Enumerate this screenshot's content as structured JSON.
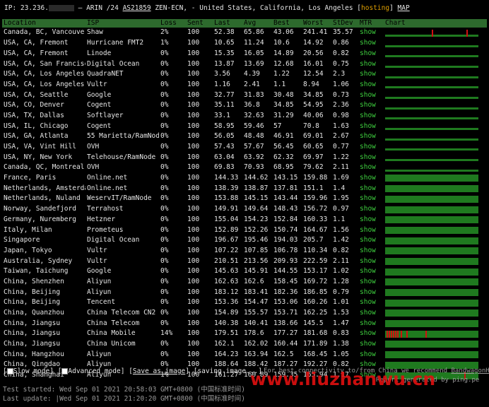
{
  "header": {
    "ip_prefix": "IP: 23.236.",
    "ip_tail": " – ARIN /24 ",
    "asn": "AS21859",
    "rest": " ZEN-ECN, - United States, California, Los Angeles [",
    "hosting": "hosting",
    "close": "] ",
    "map": "MAP"
  },
  "columns": [
    "Location",
    "ISP",
    "Loss",
    "Sent",
    "Last",
    "Avg",
    "Best",
    "Worst",
    "StDev",
    "MTR",
    "Chart"
  ],
  "rows": [
    {
      "location": "Canada, BC, Vancouver",
      "isp": "Shaw",
      "loss": "2%",
      "sent": "100",
      "last": "52.38",
      "avg": "65.86",
      "best": "43.06",
      "worst": "241.41",
      "stdev": "35.57",
      "mtr": "show",
      "chart": "spikes2"
    },
    {
      "location": "USA, CA, Fremont",
      "isp": "Hurricane FMT2",
      "loss": "1%",
      "sent": "100",
      "last": "10.65",
      "avg": "11.24",
      "best": "10.6",
      "worst": "14.92",
      "stdev": "0.86",
      "mtr": "show",
      "chart": "low"
    },
    {
      "location": "USA, CA, Fremont",
      "isp": "Linode",
      "loss": "0%",
      "sent": "100",
      "last": "15.35",
      "avg": "16.05",
      "best": "14.89",
      "worst": "20.56",
      "stdev": "0.82",
      "mtr": "show",
      "chart": "low"
    },
    {
      "location": "USA, CA, San Francisco",
      "isp": "Digital Ocean",
      "loss": "0%",
      "sent": "100",
      "last": "13.87",
      "avg": "13.69",
      "best": "12.68",
      "worst": "16.01",
      "stdev": "0.75",
      "mtr": "show",
      "chart": "low"
    },
    {
      "location": "USA, CA, Los Angeles",
      "isp": "QuadraNET",
      "loss": "0%",
      "sent": "100",
      "last": "3.56",
      "avg": "4.39",
      "best": "1.22",
      "worst": "12.54",
      "stdev": "2.3",
      "mtr": "show",
      "chart": "low"
    },
    {
      "location": "USA, CA, Los Angeles",
      "isp": "Vultr",
      "loss": "0%",
      "sent": "100",
      "last": "1.16",
      "avg": "2.41",
      "best": "1.1",
      "worst": "8.94",
      "stdev": "1.06",
      "mtr": "show",
      "chart": "low"
    },
    {
      "location": "USA, CA, Seattle",
      "isp": "Google",
      "loss": "0%",
      "sent": "100",
      "last": "32.77",
      "avg": "31.83",
      "best": "30.48",
      "worst": "34.85",
      "stdev": "0.73",
      "mtr": "show",
      "chart": "low"
    },
    {
      "location": "USA, CO, Denver",
      "isp": "Cogent",
      "loss": "0%",
      "sent": "100",
      "last": "35.11",
      "avg": "36.8",
      "best": "34.85",
      "worst": "54.95",
      "stdev": "2.36",
      "mtr": "show",
      "chart": "low"
    },
    {
      "location": "USA, TX, Dallas",
      "isp": "Softlayer",
      "loss": "0%",
      "sent": "100",
      "last": "33.1",
      "avg": "32.63",
      "best": "31.29",
      "worst": "40.06",
      "stdev": "0.98",
      "mtr": "show",
      "chart": "low"
    },
    {
      "location": "USA, IL, Chicago",
      "isp": "Cogent",
      "loss": "0%",
      "sent": "100",
      "last": "58.95",
      "avg": "59.46",
      "best": "57",
      "worst": "70.8",
      "stdev": "1.63",
      "mtr": "show",
      "chart": "low"
    },
    {
      "location": "USA, GA, Atlanta",
      "isp": "55 Marietta/RamNode",
      "loss": "0%",
      "sent": "100",
      "last": "56.05",
      "avg": "48.48",
      "best": "46.91",
      "worst": "69.01",
      "stdev": "2.67",
      "mtr": "show",
      "chart": "low"
    },
    {
      "location": "USA, VA, Vint Hill",
      "isp": "OVH",
      "loss": "0%",
      "sent": "100",
      "last": "57.43",
      "avg": "57.67",
      "best": "56.45",
      "worst": "60.65",
      "stdev": "0.77",
      "mtr": "show",
      "chart": "low"
    },
    {
      "location": "USA, NY, New York",
      "isp": "Telehouse/RamNode",
      "loss": "0%",
      "sent": "100",
      "last": "63.04",
      "avg": "63.92",
      "best": "62.32",
      "worst": "69.97",
      "stdev": "1.22",
      "mtr": "show",
      "chart": "low"
    },
    {
      "location": "Canada, QC, Montreal",
      "isp": "OVH",
      "loss": "0%",
      "sent": "100",
      "last": "69.83",
      "avg": "70.93",
      "best": "68.95",
      "worst": "79.62",
      "stdev": "2.11",
      "mtr": "show",
      "chart": "low"
    },
    {
      "location": "France, Paris",
      "isp": "Online.net",
      "loss": "0%",
      "sent": "100",
      "last": "144.33",
      "avg": "144.62",
      "best": "143.15",
      "worst": "159.88",
      "stdev": "1.69",
      "mtr": "show",
      "chart": "full"
    },
    {
      "location": "Netherlands, Amsterdam",
      "isp": "Online.net",
      "loss": "0%",
      "sent": "100",
      "last": "138.39",
      "avg": "138.87",
      "best": "137.81",
      "worst": "151.1",
      "stdev": "1.4",
      "mtr": "show",
      "chart": "full"
    },
    {
      "location": "Netherlands, Nuland",
      "isp": "WeservIT/RamNode",
      "loss": "0%",
      "sent": "100",
      "last": "153.88",
      "avg": "145.15",
      "best": "143.44",
      "worst": "159.96",
      "stdev": "1.95",
      "mtr": "show",
      "chart": "full"
    },
    {
      "location": "Norway, Sandefjord",
      "isp": "Terrahost",
      "loss": "0%",
      "sent": "100",
      "last": "149.91",
      "avg": "149.64",
      "best": "148.43",
      "worst": "156.72",
      "stdev": "0.97",
      "mtr": "show",
      "chart": "full"
    },
    {
      "location": "Germany, Nuremberg",
      "isp": "Hetzner",
      "loss": "0%",
      "sent": "100",
      "last": "155.04",
      "avg": "154.23",
      "best": "152.84",
      "worst": "160.33",
      "stdev": "1.1",
      "mtr": "show",
      "chart": "full"
    },
    {
      "location": "Italy, Milan",
      "isp": "Prometeus",
      "loss": "0%",
      "sent": "100",
      "last": "152.89",
      "avg": "152.26",
      "best": "150.74",
      "worst": "164.67",
      "stdev": "1.56",
      "mtr": "show",
      "chart": "full"
    },
    {
      "location": "Singapore",
      "isp": "Digital Ocean",
      "loss": "0%",
      "sent": "100",
      "last": "196.67",
      "avg": "195.46",
      "best": "194.03",
      "worst": "205.7",
      "stdev": "1.42",
      "mtr": "show",
      "chart": "full"
    },
    {
      "location": "Japan, Tokyo",
      "isp": "Vultr",
      "loss": "0%",
      "sent": "100",
      "last": "107.22",
      "avg": "107.85",
      "best": "106.78",
      "worst": "110.34",
      "stdev": "0.82",
      "mtr": "show",
      "chart": "full"
    },
    {
      "location": "Australia, Sydney",
      "isp": "Vultr",
      "loss": "0%",
      "sent": "100",
      "last": "210.51",
      "avg": "213.56",
      "best": "209.93",
      "worst": "222.59",
      "stdev": "2.11",
      "mtr": "show",
      "chart": "full"
    },
    {
      "location": "Taiwan, Taichung",
      "isp": "Google",
      "loss": "0%",
      "sent": "100",
      "last": "145.63",
      "avg": "145.91",
      "best": "144.55",
      "worst": "153.17",
      "stdev": "1.02",
      "mtr": "show",
      "chart": "full"
    },
    {
      "location": "China, Shenzhen",
      "isp": "Aliyun",
      "loss": "0%",
      "sent": "100",
      "last": "162.63",
      "avg": "162.6",
      "best": "158.45",
      "worst": "169.72",
      "stdev": "1.28",
      "mtr": "show",
      "chart": "full"
    },
    {
      "location": "China, Beijing",
      "isp": "Aliyun",
      "loss": "0%",
      "sent": "100",
      "last": "183.12",
      "avg": "183.41",
      "best": "182.36",
      "worst": "186.85",
      "stdev": "0.79",
      "mtr": "show",
      "chart": "full"
    },
    {
      "location": "China, Beijing",
      "isp": "Tencent",
      "loss": "0%",
      "sent": "100",
      "last": "153.36",
      "avg": "154.47",
      "best": "153.06",
      "worst": "160.26",
      "stdev": "1.01",
      "mtr": "show",
      "chart": "full"
    },
    {
      "location": "China, Quanzhou",
      "isp": "China Telecom CN2",
      "loss": "0%",
      "sent": "100",
      "last": "154.89",
      "avg": "155.57",
      "best": "153.71",
      "worst": "162.25",
      "stdev": "1.53",
      "mtr": "show",
      "chart": "full"
    },
    {
      "location": "China, Jiangsu",
      "isp": "China Telecom",
      "loss": "0%",
      "sent": "100",
      "last": "140.38",
      "avg": "140.41",
      "best": "138.66",
      "worst": "145.5",
      "stdev": "1.47",
      "mtr": "show",
      "chart": "full"
    },
    {
      "location": "China, Jiangsu",
      "isp": "China Mobile",
      "loss": "14%",
      "sent": "100",
      "last": "179.51",
      "avg": "178.6",
      "best": "177.27",
      "worst": "181.68",
      "stdev": "0.83",
      "mtr": "show",
      "chart": "mobile"
    },
    {
      "location": "China, Jiangsu",
      "isp": "China Unicom",
      "loss": "0%",
      "sent": "100",
      "last": "162.1",
      "avg": "162.02",
      "best": "160.44",
      "worst": "171.89",
      "stdev": "1.38",
      "mtr": "show",
      "chart": "full"
    },
    {
      "location": "China, Hangzhou",
      "isp": "Aliyun",
      "loss": "0%",
      "sent": "100",
      "last": "164.23",
      "avg": "163.94",
      "best": "162.5",
      "worst": "168.45",
      "stdev": "1.05",
      "mtr": "show",
      "chart": "full"
    },
    {
      "location": "China, Qingdao",
      "isp": "Aliyun",
      "loss": "0%",
      "sent": "100",
      "last": "188.64",
      "avg": "188.42",
      "best": "187.27",
      "worst": "192.27",
      "stdev": "0.82",
      "mtr": "show",
      "chart": "full"
    },
    {
      "location": "China, Shanghai",
      "isp": "Aliyun",
      "loss": "1%",
      "sent": "100",
      "last": "161.27",
      "avg": "160.89",
      "best": "159.35",
      "worst": "165.94",
      "stdev": "1.17",
      "mtr": "show",
      "chart": "spike1"
    }
  ],
  "footer": {
    "slow_mode": "Slow mode]",
    "advanced_mode": "Advanced mode]",
    "save_as_image": "Save as image",
    "saving": " [saving image...]",
    "recommend": "For best connectivity to/from China we recommend ",
    "bandwagon": "BandwagonHost.",
    "generated": "Report generated by ping.pe",
    "test_started": "Test started: Wed Sep 01 2021 20:58:03 GMT+0800 (中国标准时间)",
    "last_update": "Last update: |Wed Sep 01 2021 21:20:20 GMT+0800 (中国标准时间)",
    "watermark": "www.liuzhanwu.cn"
  },
  "colors": {
    "header_bg": "#2d6a2d",
    "bar": "#1f7a1f",
    "loss_spike": "#d01010",
    "mtr_link": "#3ecf3e",
    "hosting": "#e0a000"
  }
}
